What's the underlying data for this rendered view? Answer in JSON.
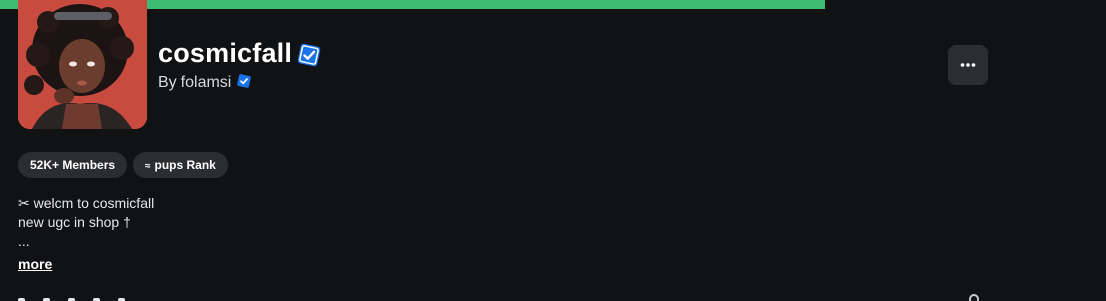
{
  "progress": {
    "fill_percent": 100,
    "color": "#3dbb70"
  },
  "group": {
    "name": "cosmicfall",
    "owner_prefix": "By",
    "owner": "folamsi",
    "avatar_icon": "group-avatar-image",
    "verified_icon": "verified-badge-icon"
  },
  "stats": {
    "members_label": "52K+ Members",
    "rank_icon": "≈",
    "rank_label": "pups Rank"
  },
  "description": {
    "line1": "✂ welcm to cosmicfall",
    "line2": "new ugc in shop †",
    "line3": "...",
    "more_label": "more"
  },
  "colors": {
    "background": "#111214",
    "pill_bg": "#2b2d31",
    "accent_blue": "#1a73e8",
    "progress_green": "#3dbb70"
  }
}
